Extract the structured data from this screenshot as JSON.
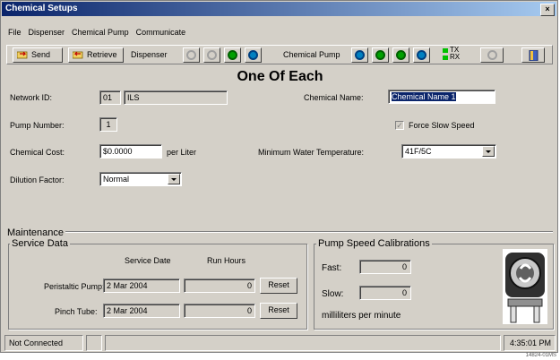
{
  "window": {
    "title": "Chemical Setups",
    "close_glyph": "×"
  },
  "menu": [
    {
      "label": "File"
    },
    {
      "label": "Dispenser"
    },
    {
      "label": "Chemical Pump"
    },
    {
      "label": "Communicate"
    }
  ],
  "toolbar": {
    "send_label": "Send",
    "retrieve_label": "Retrieve",
    "dispenser_label": "Dispenser",
    "chemical_pump_label": "Chemical Pump",
    "tx_label": "TX",
    "rx_label": "RX",
    "colors": {
      "tx": "#00c000",
      "rx": "#00c000",
      "nav_active": "#0080c0",
      "nav_green": "#00a000",
      "disabled": "#a0a0a0"
    }
  },
  "heading": "One Of Each",
  "form": {
    "network_id_label": "Network ID:",
    "network_id_value": "01",
    "network_name_value": "ILS",
    "chemical_name_label": "Chemical Name:",
    "chemical_name_value": "Chemical Name 1",
    "pump_number_label": "Pump Number:",
    "pump_number_value": "1",
    "force_slow_label": "Force Slow Speed",
    "chemical_cost_label": "Chemical Cost:",
    "chemical_cost_value": "$0.0000",
    "per_liter": "per Liter",
    "min_water_temp_label": "Minimum Water Temperature:",
    "min_water_temp_value": "41F/5C",
    "dilution_label": "Dilution Factor:",
    "dilution_value": "Normal"
  },
  "maintenance": {
    "title": "Maintenance",
    "service_title": "Service Data",
    "col_service_date": "Service Date",
    "col_run_hours": "Run Hours",
    "rows": [
      {
        "label": "Peristaltic Pump:",
        "date": "2 Mar 2004",
        "hours": "0",
        "reset": "Reset"
      },
      {
        "label": "Pinch Tube:",
        "date": "2 Mar 2004",
        "hours": "0",
        "reset": "Reset"
      }
    ]
  },
  "calibration": {
    "title": "Pump Speed Calibrations",
    "fast_label": "Fast:",
    "fast_value": "0",
    "slow_label": "Slow:",
    "slow_value": "0",
    "units": "milliliters per minute"
  },
  "status": {
    "connection": "Not Connected",
    "time": "4:35:01 PM"
  },
  "image_id": "14824-01MS"
}
